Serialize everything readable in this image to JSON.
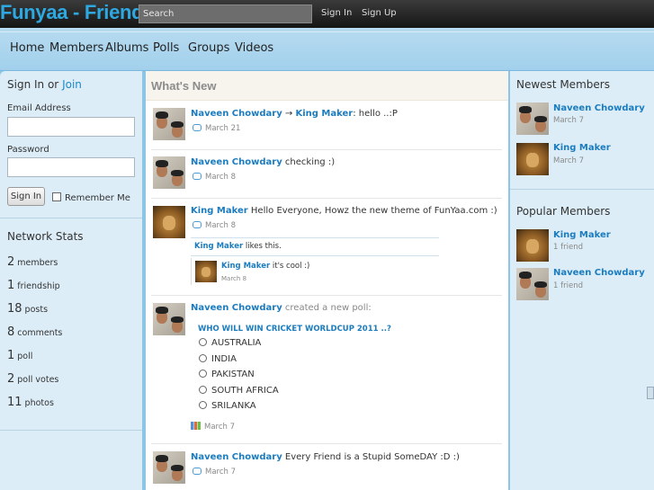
{
  "brand": {
    "logo": "Funyaa - Friend",
    "accent": "#2ea8e0",
    "link_color": "#1b7cbf"
  },
  "topbar": {
    "search_placeholder": "Search",
    "sign_in": "Sign In",
    "sign_up": "Sign Up"
  },
  "nav": [
    "Home",
    "Members",
    "Albums",
    "Polls",
    "Groups",
    "Videos"
  ],
  "login": {
    "heading": "Sign In or",
    "join": "Join",
    "email_label": "Email Address",
    "email_value": "",
    "password_label": "Password",
    "password_value": "",
    "submit": "Sign In",
    "remember": "Remember Me"
  },
  "stats": {
    "heading": "Network Stats",
    "items": [
      {
        "num": "2",
        "label": "members"
      },
      {
        "num": "1",
        "label": "friendship"
      },
      {
        "num": "18",
        "label": "posts"
      },
      {
        "num": "8",
        "label": "comments"
      },
      {
        "num": "1",
        "label": "poll"
      },
      {
        "num": "2",
        "label": "poll votes"
      },
      {
        "num": "11",
        "label": "photos"
      }
    ]
  },
  "feed": {
    "heading": "What's New",
    "items": [
      {
        "author": "Naveen Chowdary",
        "arrow": " → ",
        "target": "King Maker",
        "text": ": hello ..:P",
        "date": "March 21"
      },
      {
        "author": "Naveen Chowdary",
        "text": " checking :)",
        "date": "March 8"
      },
      {
        "author": "King Maker",
        "text": " Hello Everyone, Howz the new theme of FunYaa.com :)",
        "date": "March 8",
        "like_user": "King Maker",
        "like_text": " likes this.",
        "comment_author": "King Maker",
        "comment_text": " it's cool :)",
        "comment_date": "March 8"
      },
      {
        "author": "Naveen Chowdary",
        "text": " created a new poll:",
        "date": "March 7",
        "poll_question": "WHO WILL WIN CRICKET WORLDCUP 2011 ..?",
        "poll_options": [
          "AUSTRALIA",
          "INDIA",
          "PAKISTAN",
          "SOUTH AFRICA",
          "SRILANKA"
        ]
      },
      {
        "author": "Naveen Chowdary",
        "text": " Every Friend is a Stupid SomeDAY :D :)",
        "date": "March 7"
      }
    ]
  },
  "newest": {
    "heading": "Newest Members",
    "items": [
      {
        "name": "Naveen Chowdary",
        "sub": "March 7"
      },
      {
        "name": "King Maker",
        "sub": "March 7"
      }
    ]
  },
  "popular": {
    "heading": "Popular Members",
    "items": [
      {
        "name": "King Maker",
        "sub": "1 friend"
      },
      {
        "name": "Naveen Chowdary",
        "sub": "1 friend"
      }
    ]
  }
}
